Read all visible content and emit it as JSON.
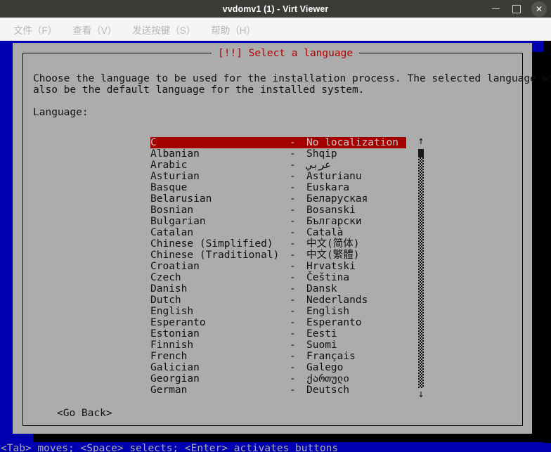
{
  "window": {
    "title": "vvdomv1 (1) - Virt Viewer",
    "controls": {
      "minimize": "minimize",
      "maximize": "maximize",
      "close": "✕"
    }
  },
  "menubar": {
    "items": [
      {
        "label": "文件（F）"
      },
      {
        "label": "查看（V）"
      },
      {
        "label": "发送按键（S）"
      },
      {
        "label": "帮助（H）"
      }
    ]
  },
  "installer": {
    "dialog_title": "[!!] Select a language",
    "description": "Choose the language to be used for the installation process. The selected language will\nalso be the default language for the installed system.",
    "field_label": "Language:",
    "go_back_label": "<Go Back>",
    "status_line": "<Tab> moves; <Space> selects; <Enter> activates buttons",
    "scrollbar": {
      "up_arrow": "↑",
      "down_arrow": "↓"
    },
    "languages": [
      {
        "english": "C",
        "dash": "-",
        "native": "No localization",
        "selected": true
      },
      {
        "english": "Albanian",
        "dash": "-",
        "native": "Shqip",
        "selected": false
      },
      {
        "english": "Arabic",
        "dash": "-",
        "native": "عربي",
        "selected": false
      },
      {
        "english": "Asturian",
        "dash": "-",
        "native": "Asturianu",
        "selected": false
      },
      {
        "english": "Basque",
        "dash": "-",
        "native": "Euskara",
        "selected": false
      },
      {
        "english": "Belarusian",
        "dash": "-",
        "native": "Беларуская",
        "selected": false
      },
      {
        "english": "Bosnian",
        "dash": "-",
        "native": "Bosanski",
        "selected": false
      },
      {
        "english": "Bulgarian",
        "dash": "-",
        "native": "Български",
        "selected": false
      },
      {
        "english": "Catalan",
        "dash": "-",
        "native": "Català",
        "selected": false
      },
      {
        "english": "Chinese (Simplified)",
        "dash": "-",
        "native": "中文(简体)",
        "selected": false
      },
      {
        "english": "Chinese (Traditional)",
        "dash": "-",
        "native": "中文(繁體)",
        "selected": false
      },
      {
        "english": "Croatian",
        "dash": "-",
        "native": "Hrvatski",
        "selected": false
      },
      {
        "english": "Czech",
        "dash": "-",
        "native": "Čeština",
        "selected": false
      },
      {
        "english": "Danish",
        "dash": "-",
        "native": "Dansk",
        "selected": false
      },
      {
        "english": "Dutch",
        "dash": "-",
        "native": "Nederlands",
        "selected": false
      },
      {
        "english": "English",
        "dash": "-",
        "native": "English",
        "selected": false
      },
      {
        "english": "Esperanto",
        "dash": "-",
        "native": "Esperanto",
        "selected": false
      },
      {
        "english": "Estonian",
        "dash": "-",
        "native": "Eesti",
        "selected": false
      },
      {
        "english": "Finnish",
        "dash": "-",
        "native": "Suomi",
        "selected": false
      },
      {
        "english": "French",
        "dash": "-",
        "native": "Français",
        "selected": false
      },
      {
        "english": "Galician",
        "dash": "-",
        "native": "Galego",
        "selected": false
      },
      {
        "english": "Georgian",
        "dash": "-",
        "native": "ქართული",
        "selected": false
      },
      {
        "english": "German",
        "dash": "-",
        "native": "Deutsch",
        "selected": false
      }
    ]
  },
  "colors": {
    "titlebar_bg": "#3c3b37",
    "menubar_bg": "#f6f5f4",
    "tui_blue": "#0000b0",
    "dialog_gray": "#acacac",
    "dialog_title_red": "#b40000",
    "selection_red": "#a40000",
    "selection_text": "#c8c8c8"
  }
}
